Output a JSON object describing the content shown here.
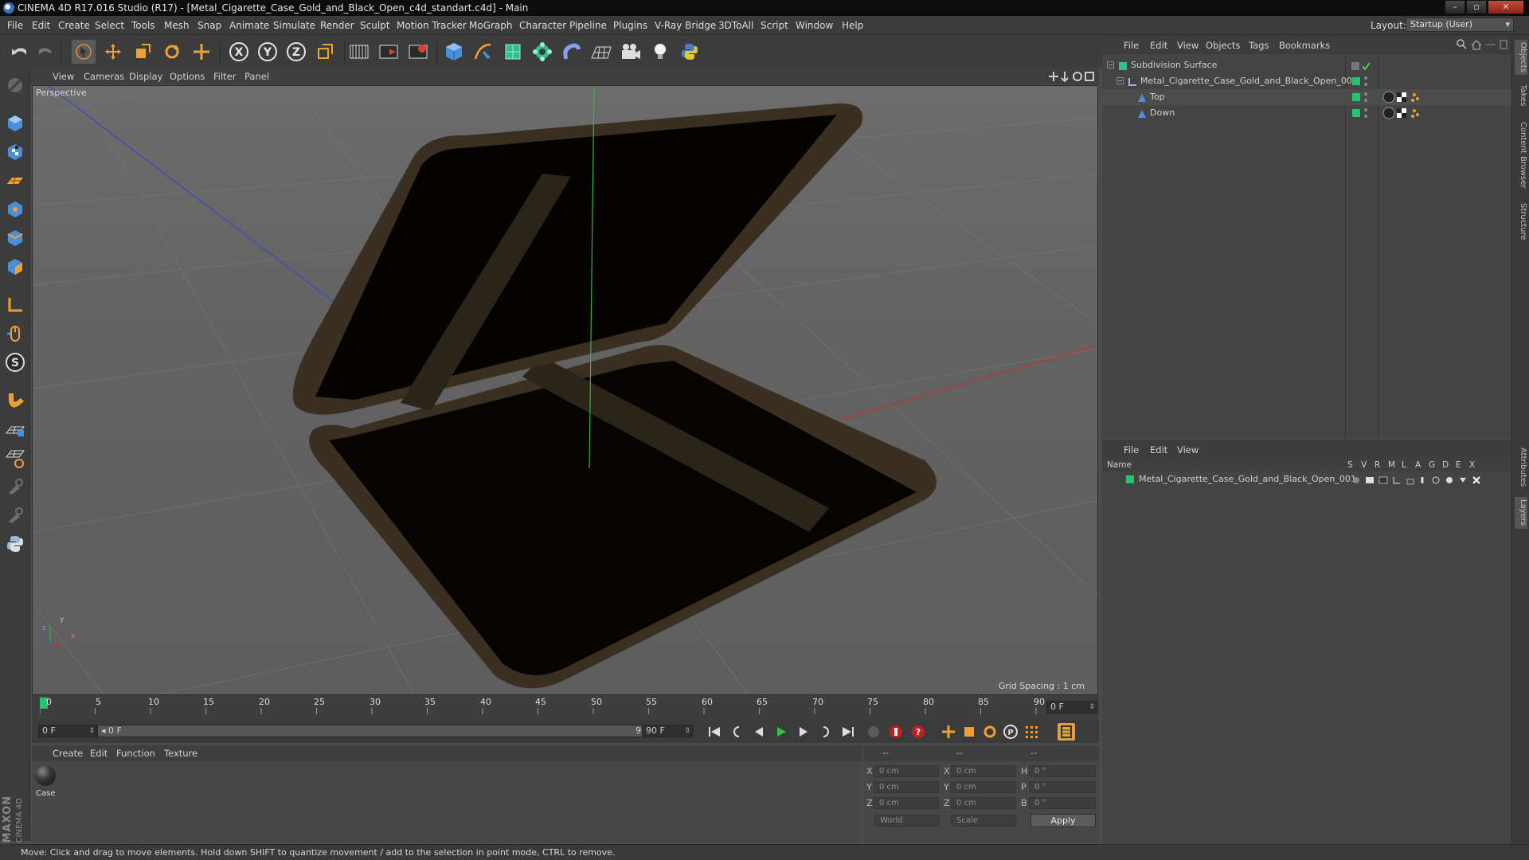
{
  "window": {
    "title": "CINEMA 4D R17.016 Studio (R17) - [Metal_Cigarette_Case_Gold_and_Black_Open_c4d_standart.c4d] - Main",
    "controls": [
      "–",
      "▫",
      "✕"
    ]
  },
  "menubar": {
    "items": [
      "File",
      "Edit",
      "Create",
      "Select",
      "Tools",
      "Mesh",
      "Snap",
      "Animate",
      "Simulate",
      "Render",
      "Sculpt",
      "Motion Tracker",
      "MoGraph",
      "Character",
      "Pipeline",
      "Plugins",
      "V-Ray Bridge",
      "3DToAll",
      "Script",
      "Window",
      "Help"
    ],
    "layout_label": "Layout:",
    "layout_value": "Startup (User)"
  },
  "viewport": {
    "menu": [
      "View",
      "Cameras",
      "Display",
      "Options",
      "Filter",
      "Panel"
    ],
    "camera_label": "Perspective",
    "grid_spacing": "Grid Spacing : 1 cm",
    "axis_x": "x",
    "axis_y": "y",
    "axis_z": "z"
  },
  "timeline": {
    "ticks": [
      "0",
      "5",
      "10",
      "15",
      "20",
      "25",
      "30",
      "35",
      "40",
      "45",
      "50",
      "55",
      "60",
      "65",
      "70",
      "75",
      "80",
      "85",
      "90"
    ],
    "current_frame": "0 F"
  },
  "transport": {
    "start_field": "0 F",
    "range_start": "◂ 0 F",
    "range_end": "90 F ▸",
    "end_field": "90 F"
  },
  "material_manager": {
    "menu": [
      "Create",
      "Edit",
      "Function",
      "Texture"
    ],
    "materials": [
      {
        "name": "Case"
      }
    ]
  },
  "coordinates": {
    "headers": [
      "--",
      "--",
      "--"
    ],
    "rows": [
      {
        "l1": "X",
        "v1": "0 cm",
        "l2": "X",
        "v2": "0 cm",
        "l3": "H",
        "v3": "0 °"
      },
      {
        "l1": "Y",
        "v1": "0 cm",
        "l2": "Y",
        "v2": "0 cm",
        "l3": "P",
        "v3": "0 °"
      },
      {
        "l1": "Z",
        "v1": "0 cm",
        "l2": "Z",
        "v2": "0 cm",
        "l3": "B",
        "v3": "0 °"
      }
    ],
    "mode_world": "World",
    "mode_scale": "Scale",
    "apply": "Apply"
  },
  "object_manager": {
    "menu": [
      "File",
      "Edit",
      "View",
      "Objects",
      "Tags",
      "Bookmarks"
    ],
    "objects": [
      {
        "name": "Subdivision Surface",
        "indent": 0
      },
      {
        "name": "Metal_Cigarette_Case_Gold_and_Black_Open_001",
        "indent": 1
      },
      {
        "name": "Top",
        "indent": 2
      },
      {
        "name": "Down",
        "indent": 2
      }
    ]
  },
  "layer_manager": {
    "menu": [
      "File",
      "Edit",
      "View"
    ],
    "col_name": "Name",
    "cols": [
      "S",
      "V",
      "R",
      "M",
      "L",
      "A",
      "G",
      "D",
      "E",
      "X"
    ],
    "layers": [
      {
        "name": "Metal_Cigarette_Case_Gold_and_Black_Open_001"
      }
    ]
  },
  "right_tabs": [
    "Objects",
    "Takes",
    "Content Browser",
    "Structure",
    "Attributes",
    "Layers"
  ],
  "branding": {
    "maxon": "MAXON",
    "cinema": "CINEMA 4D"
  },
  "status": {
    "text": "Move: Click and drag to move elements. Hold down SHIFT to quantize movement / add to the selection in point mode, CTRL to remove."
  },
  "colors": {
    "accent_blue": "#4a90d9",
    "active_orange": "#f0a030",
    "layer_green": "#27c46e",
    "case_gold": "#3e3323"
  }
}
